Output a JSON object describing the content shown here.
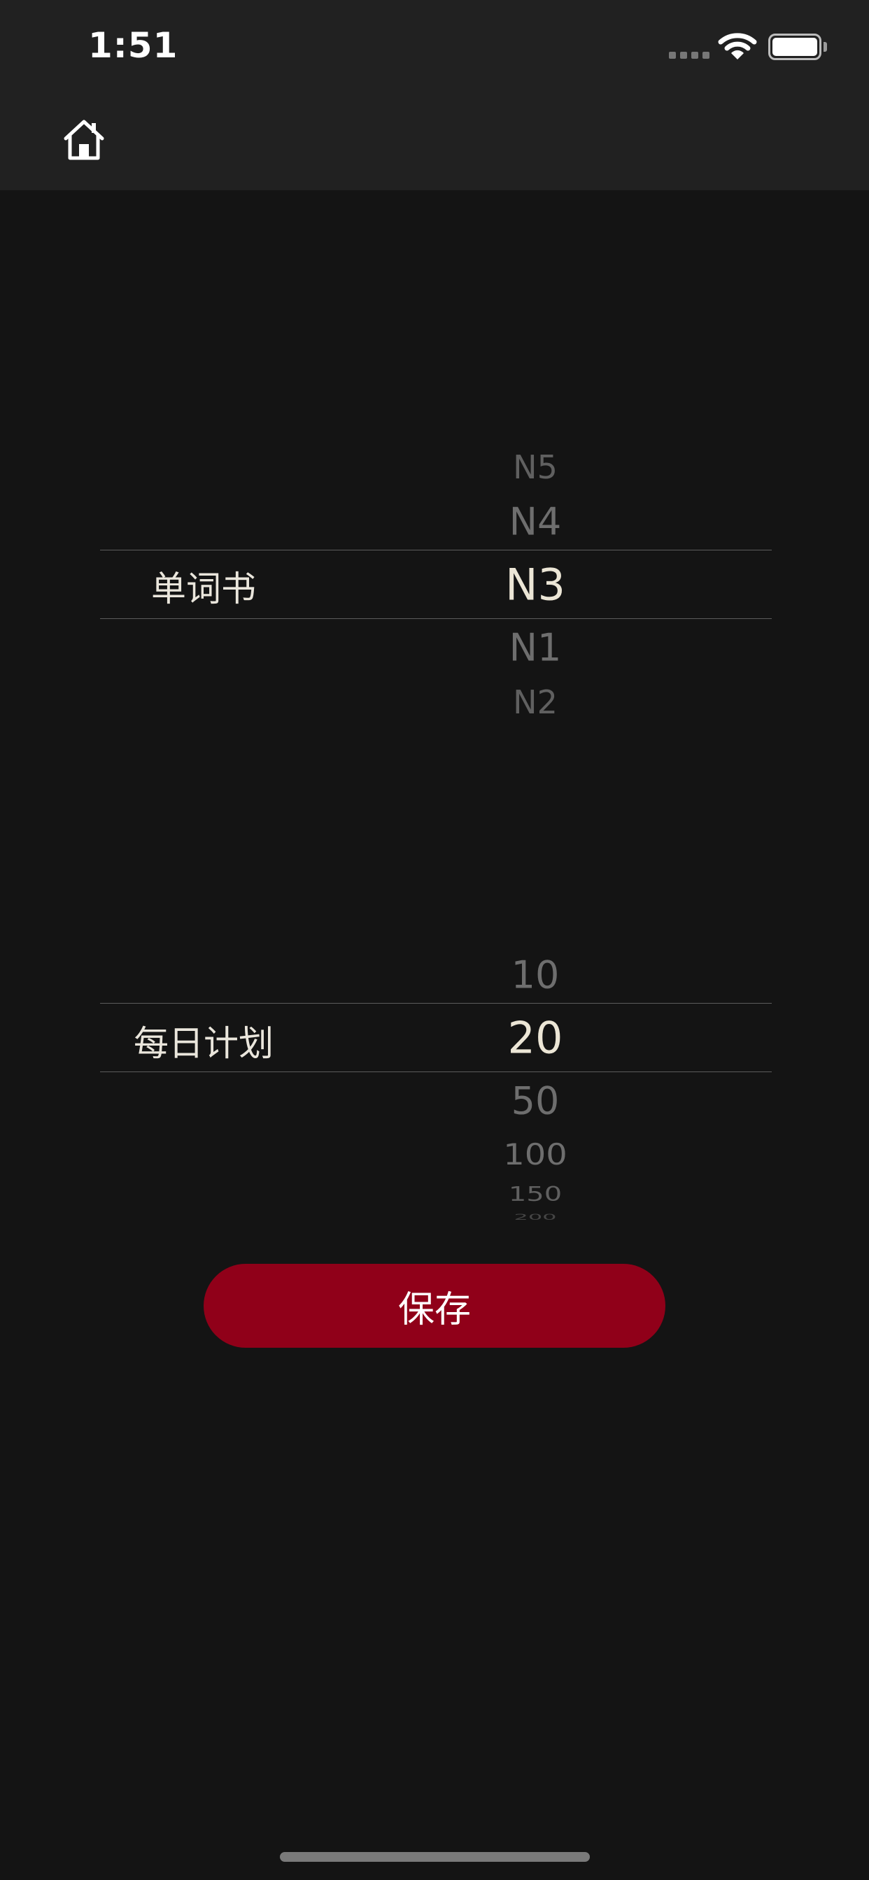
{
  "status_bar": {
    "time": "1:51"
  },
  "nav": {
    "home_icon": "home-icon"
  },
  "book_picker": {
    "label": "单词书",
    "options_above": [
      "N5",
      "N4"
    ],
    "selected": "N3",
    "options_below": [
      "N1",
      "N2"
    ]
  },
  "plan_picker": {
    "label": "每日计划",
    "options_above": [
      "10"
    ],
    "selected": "20",
    "options_below": [
      "50",
      "100",
      "150",
      "200"
    ]
  },
  "save_button": {
    "label": "保存",
    "color": "#900019"
  },
  "colors": {
    "background": "#141414",
    "header": "#212121",
    "selected_text": "#ece6d6",
    "dim_text": "#6e6e6e"
  }
}
